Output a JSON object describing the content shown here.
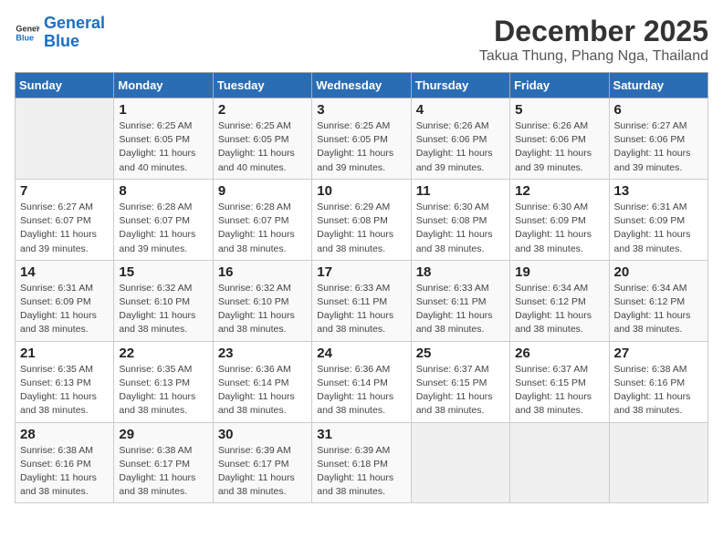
{
  "header": {
    "logo_line1": "General",
    "logo_line2": "Blue",
    "month": "December 2025",
    "location": "Takua Thung, Phang Nga, Thailand"
  },
  "weekdays": [
    "Sunday",
    "Monday",
    "Tuesday",
    "Wednesday",
    "Thursday",
    "Friday",
    "Saturday"
  ],
  "weeks": [
    [
      {
        "day": "",
        "info": ""
      },
      {
        "day": "1",
        "info": "Sunrise: 6:25 AM\nSunset: 6:05 PM\nDaylight: 11 hours\nand 40 minutes."
      },
      {
        "day": "2",
        "info": "Sunrise: 6:25 AM\nSunset: 6:05 PM\nDaylight: 11 hours\nand 40 minutes."
      },
      {
        "day": "3",
        "info": "Sunrise: 6:25 AM\nSunset: 6:05 PM\nDaylight: 11 hours\nand 39 minutes."
      },
      {
        "day": "4",
        "info": "Sunrise: 6:26 AM\nSunset: 6:06 PM\nDaylight: 11 hours\nand 39 minutes."
      },
      {
        "day": "5",
        "info": "Sunrise: 6:26 AM\nSunset: 6:06 PM\nDaylight: 11 hours\nand 39 minutes."
      },
      {
        "day": "6",
        "info": "Sunrise: 6:27 AM\nSunset: 6:06 PM\nDaylight: 11 hours\nand 39 minutes."
      }
    ],
    [
      {
        "day": "7",
        "info": "Sunrise: 6:27 AM\nSunset: 6:07 PM\nDaylight: 11 hours\nand 39 minutes."
      },
      {
        "day": "8",
        "info": "Sunrise: 6:28 AM\nSunset: 6:07 PM\nDaylight: 11 hours\nand 39 minutes."
      },
      {
        "day": "9",
        "info": "Sunrise: 6:28 AM\nSunset: 6:07 PM\nDaylight: 11 hours\nand 38 minutes."
      },
      {
        "day": "10",
        "info": "Sunrise: 6:29 AM\nSunset: 6:08 PM\nDaylight: 11 hours\nand 38 minutes."
      },
      {
        "day": "11",
        "info": "Sunrise: 6:30 AM\nSunset: 6:08 PM\nDaylight: 11 hours\nand 38 minutes."
      },
      {
        "day": "12",
        "info": "Sunrise: 6:30 AM\nSunset: 6:09 PM\nDaylight: 11 hours\nand 38 minutes."
      },
      {
        "day": "13",
        "info": "Sunrise: 6:31 AM\nSunset: 6:09 PM\nDaylight: 11 hours\nand 38 minutes."
      }
    ],
    [
      {
        "day": "14",
        "info": "Sunrise: 6:31 AM\nSunset: 6:09 PM\nDaylight: 11 hours\nand 38 minutes."
      },
      {
        "day": "15",
        "info": "Sunrise: 6:32 AM\nSunset: 6:10 PM\nDaylight: 11 hours\nand 38 minutes."
      },
      {
        "day": "16",
        "info": "Sunrise: 6:32 AM\nSunset: 6:10 PM\nDaylight: 11 hours\nand 38 minutes."
      },
      {
        "day": "17",
        "info": "Sunrise: 6:33 AM\nSunset: 6:11 PM\nDaylight: 11 hours\nand 38 minutes."
      },
      {
        "day": "18",
        "info": "Sunrise: 6:33 AM\nSunset: 6:11 PM\nDaylight: 11 hours\nand 38 minutes."
      },
      {
        "day": "19",
        "info": "Sunrise: 6:34 AM\nSunset: 6:12 PM\nDaylight: 11 hours\nand 38 minutes."
      },
      {
        "day": "20",
        "info": "Sunrise: 6:34 AM\nSunset: 6:12 PM\nDaylight: 11 hours\nand 38 minutes."
      }
    ],
    [
      {
        "day": "21",
        "info": "Sunrise: 6:35 AM\nSunset: 6:13 PM\nDaylight: 11 hours\nand 38 minutes."
      },
      {
        "day": "22",
        "info": "Sunrise: 6:35 AM\nSunset: 6:13 PM\nDaylight: 11 hours\nand 38 minutes."
      },
      {
        "day": "23",
        "info": "Sunrise: 6:36 AM\nSunset: 6:14 PM\nDaylight: 11 hours\nand 38 minutes."
      },
      {
        "day": "24",
        "info": "Sunrise: 6:36 AM\nSunset: 6:14 PM\nDaylight: 11 hours\nand 38 minutes."
      },
      {
        "day": "25",
        "info": "Sunrise: 6:37 AM\nSunset: 6:15 PM\nDaylight: 11 hours\nand 38 minutes."
      },
      {
        "day": "26",
        "info": "Sunrise: 6:37 AM\nSunset: 6:15 PM\nDaylight: 11 hours\nand 38 minutes."
      },
      {
        "day": "27",
        "info": "Sunrise: 6:38 AM\nSunset: 6:16 PM\nDaylight: 11 hours\nand 38 minutes."
      }
    ],
    [
      {
        "day": "28",
        "info": "Sunrise: 6:38 AM\nSunset: 6:16 PM\nDaylight: 11 hours\nand 38 minutes."
      },
      {
        "day": "29",
        "info": "Sunrise: 6:38 AM\nSunset: 6:17 PM\nDaylight: 11 hours\nand 38 minutes."
      },
      {
        "day": "30",
        "info": "Sunrise: 6:39 AM\nSunset: 6:17 PM\nDaylight: 11 hours\nand 38 minutes."
      },
      {
        "day": "31",
        "info": "Sunrise: 6:39 AM\nSunset: 6:18 PM\nDaylight: 11 hours\nand 38 minutes."
      },
      {
        "day": "",
        "info": ""
      },
      {
        "day": "",
        "info": ""
      },
      {
        "day": "",
        "info": ""
      }
    ]
  ]
}
